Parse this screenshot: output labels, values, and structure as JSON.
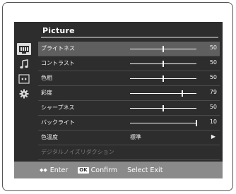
{
  "osd": {
    "title": "Picture",
    "sidebar": [
      {
        "icon": "picture-icon",
        "selected": true
      },
      {
        "icon": "music-note-icon",
        "selected": false
      },
      {
        "icon": "channel-grid-icon",
        "selected": false
      },
      {
        "icon": "settings-gear-icon",
        "selected": false
      }
    ],
    "rows": [
      {
        "label": "ブライトネス",
        "type": "slider",
        "value": "50",
        "level": 0.5,
        "selected": true
      },
      {
        "label": "コントラスト",
        "type": "slider",
        "value": "50",
        "level": 0.5
      },
      {
        "label": "色相",
        "type": "slider",
        "value": "50",
        "level": 0.5
      },
      {
        "label": "彩度",
        "type": "slider",
        "value": "79",
        "level": 0.79
      },
      {
        "label": "シャープネス",
        "type": "slider",
        "value": "50",
        "level": 0.5
      },
      {
        "label": "バックライト",
        "type": "slider",
        "value": "10",
        "level": 1.0
      },
      {
        "label": "色温度",
        "type": "select",
        "value": "標準",
        "arrow": "▶"
      },
      {
        "label": "デジタルノイズリダクション",
        "type": "disabled"
      }
    ],
    "footer": {
      "enter_symbol": "◆◆",
      "enter_label": "Enter",
      "ok_label": "OK",
      "confirm_label": "Confirm",
      "exit_label": "Select Exit"
    }
  }
}
